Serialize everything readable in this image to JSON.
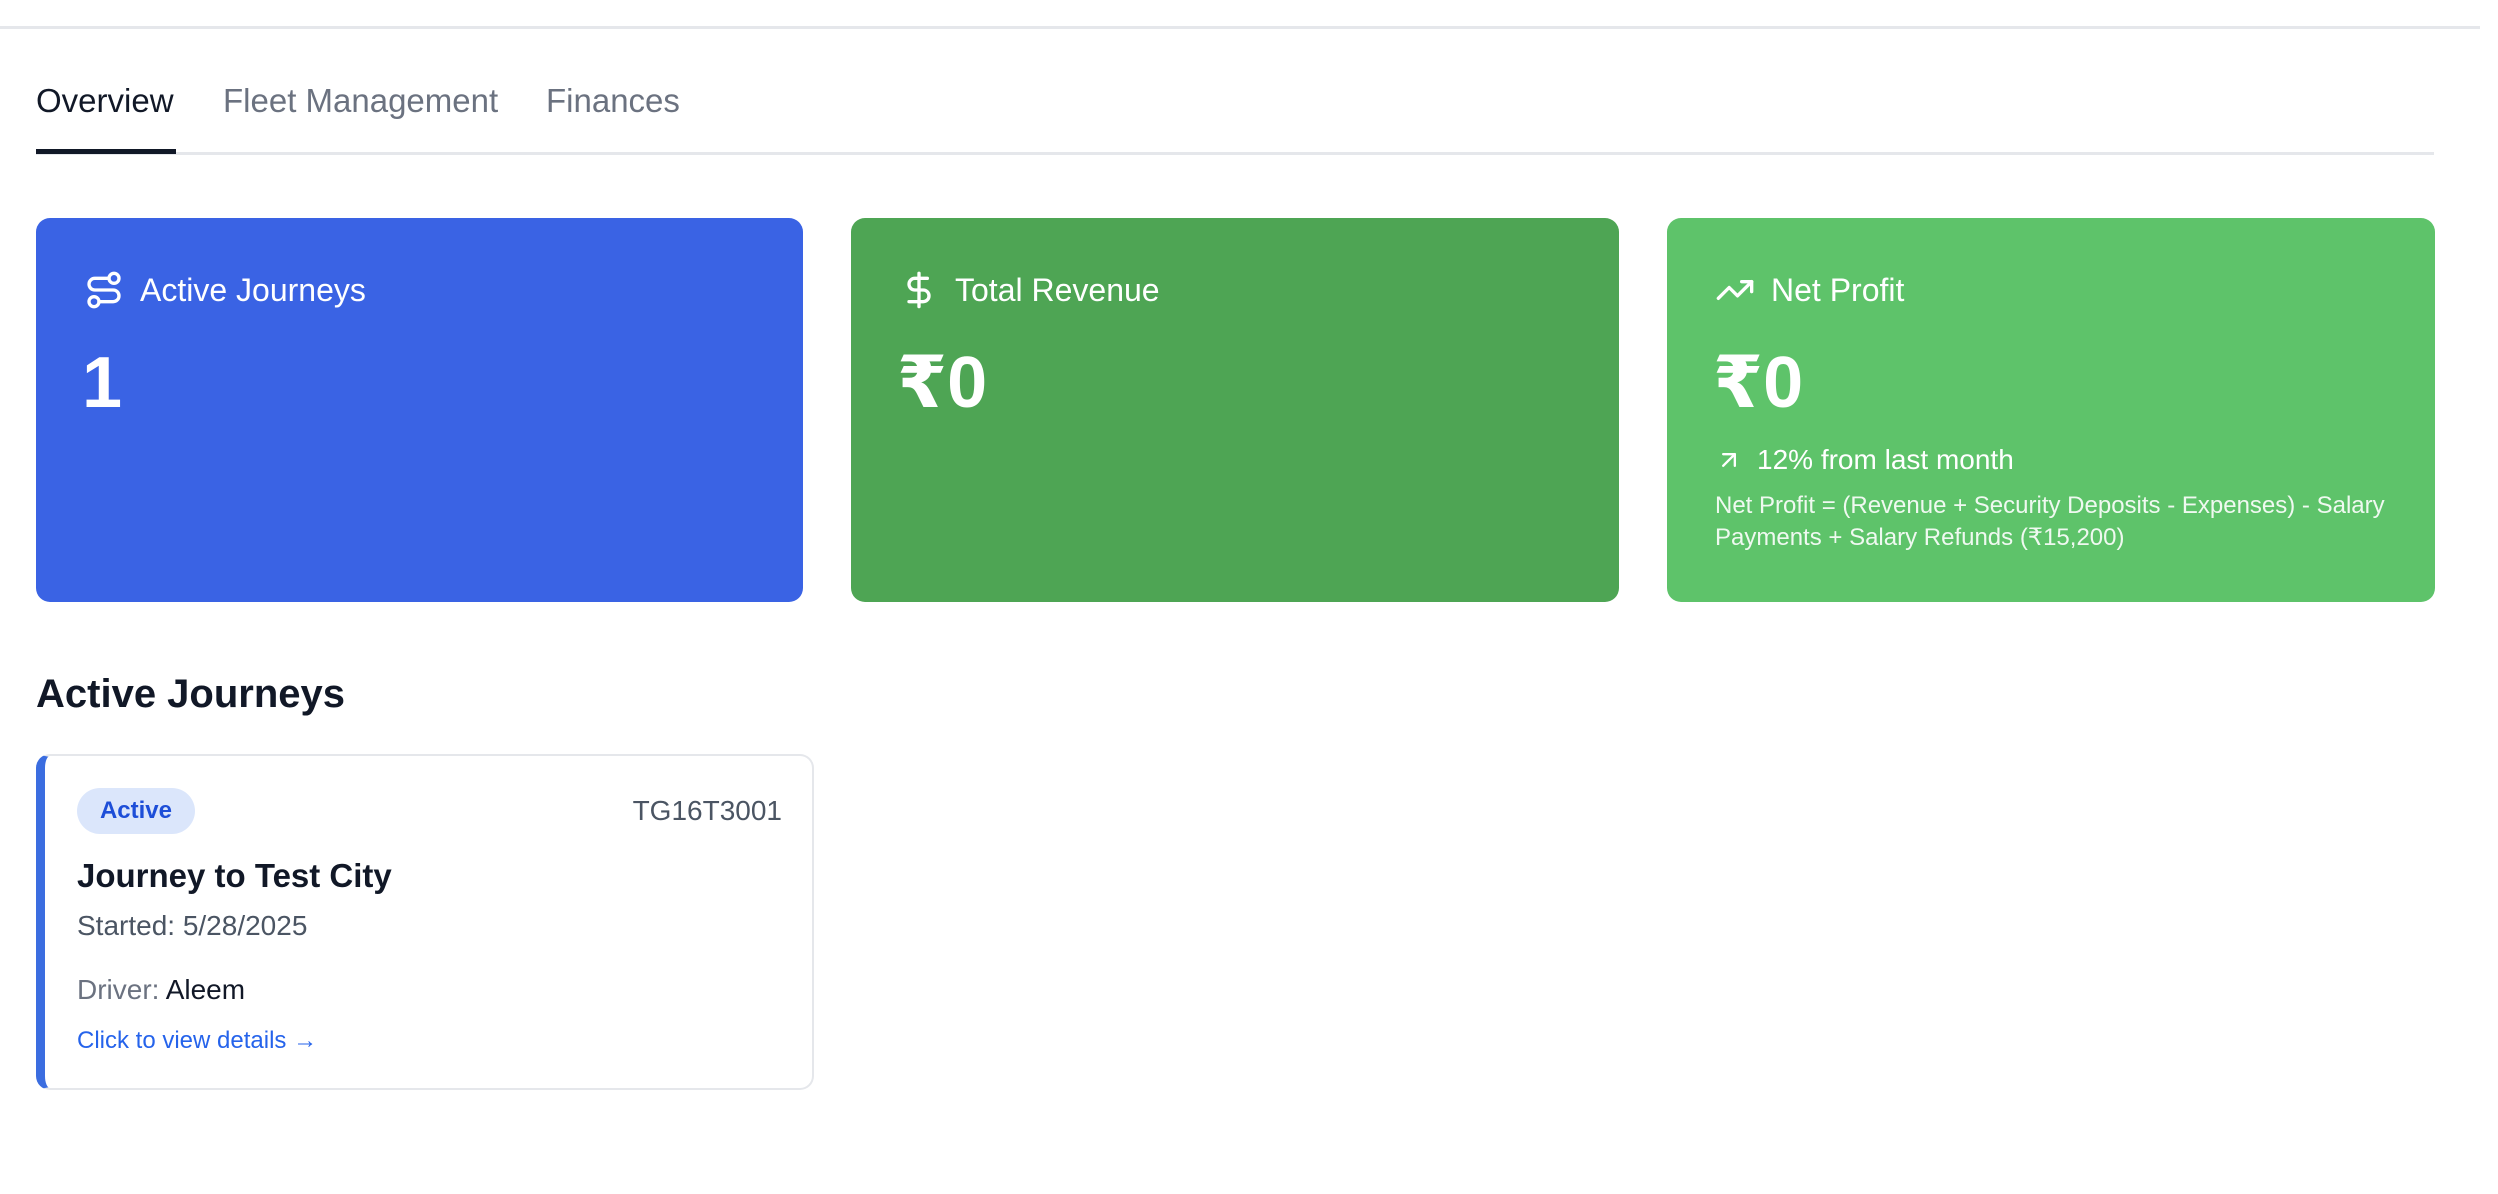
{
  "tabs": [
    {
      "label": "Overview",
      "active": true
    },
    {
      "label": "Fleet Management",
      "active": false
    },
    {
      "label": "Finances",
      "active": false
    }
  ],
  "stats": {
    "active_journeys": {
      "title": "Active Journeys",
      "value": "1",
      "icon": "route-icon",
      "color": "#3a63e4"
    },
    "total_revenue": {
      "title": "Total Revenue",
      "value": "₹0",
      "icon": "dollar-icon",
      "color": "#4ea554"
    },
    "net_profit": {
      "title": "Net Profit",
      "value": "₹0",
      "icon": "trending-up-icon",
      "color": "#5ec36a",
      "trend": "12% from last month",
      "trend_icon": "arrow-up-right-icon",
      "note": "Net Profit = (Revenue + Security Deposits - Expenses) - Salary Payments + Salary Refunds (₹15,200)"
    }
  },
  "section": {
    "title": "Active Journeys"
  },
  "journeys": [
    {
      "status": "Active",
      "plate": "TG16T3001",
      "title": "Journey to Test City",
      "started": "Started: 5/28/2025",
      "driver_label": "Driver:",
      "driver_name": "Aleem",
      "link": "Click to view details →",
      "accent": "#3b6de0"
    }
  ]
}
